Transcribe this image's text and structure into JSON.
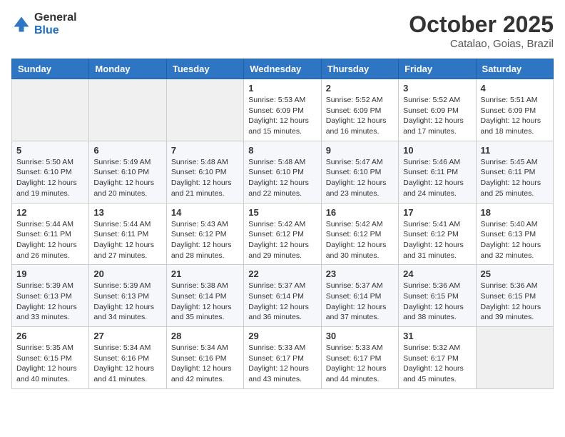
{
  "logo": {
    "general": "General",
    "blue": "Blue"
  },
  "title": "October 2025",
  "location": "Catalao, Goias, Brazil",
  "days_of_week": [
    "Sunday",
    "Monday",
    "Tuesday",
    "Wednesday",
    "Thursday",
    "Friday",
    "Saturday"
  ],
  "weeks": [
    [
      {
        "day": "",
        "sunrise": "",
        "sunset": "",
        "daylight": ""
      },
      {
        "day": "",
        "sunrise": "",
        "sunset": "",
        "daylight": ""
      },
      {
        "day": "",
        "sunrise": "",
        "sunset": "",
        "daylight": ""
      },
      {
        "day": "1",
        "sunrise": "Sunrise: 5:53 AM",
        "sunset": "Sunset: 6:09 PM",
        "daylight": "Daylight: 12 hours and 15 minutes."
      },
      {
        "day": "2",
        "sunrise": "Sunrise: 5:52 AM",
        "sunset": "Sunset: 6:09 PM",
        "daylight": "Daylight: 12 hours and 16 minutes."
      },
      {
        "day": "3",
        "sunrise": "Sunrise: 5:52 AM",
        "sunset": "Sunset: 6:09 PM",
        "daylight": "Daylight: 12 hours and 17 minutes."
      },
      {
        "day": "4",
        "sunrise": "Sunrise: 5:51 AM",
        "sunset": "Sunset: 6:09 PM",
        "daylight": "Daylight: 12 hours and 18 minutes."
      }
    ],
    [
      {
        "day": "5",
        "sunrise": "Sunrise: 5:50 AM",
        "sunset": "Sunset: 6:10 PM",
        "daylight": "Daylight: 12 hours and 19 minutes."
      },
      {
        "day": "6",
        "sunrise": "Sunrise: 5:49 AM",
        "sunset": "Sunset: 6:10 PM",
        "daylight": "Daylight: 12 hours and 20 minutes."
      },
      {
        "day": "7",
        "sunrise": "Sunrise: 5:48 AM",
        "sunset": "Sunset: 6:10 PM",
        "daylight": "Daylight: 12 hours and 21 minutes."
      },
      {
        "day": "8",
        "sunrise": "Sunrise: 5:48 AM",
        "sunset": "Sunset: 6:10 PM",
        "daylight": "Daylight: 12 hours and 22 minutes."
      },
      {
        "day": "9",
        "sunrise": "Sunrise: 5:47 AM",
        "sunset": "Sunset: 6:10 PM",
        "daylight": "Daylight: 12 hours and 23 minutes."
      },
      {
        "day": "10",
        "sunrise": "Sunrise: 5:46 AM",
        "sunset": "Sunset: 6:11 PM",
        "daylight": "Daylight: 12 hours and 24 minutes."
      },
      {
        "day": "11",
        "sunrise": "Sunrise: 5:45 AM",
        "sunset": "Sunset: 6:11 PM",
        "daylight": "Daylight: 12 hours and 25 minutes."
      }
    ],
    [
      {
        "day": "12",
        "sunrise": "Sunrise: 5:44 AM",
        "sunset": "Sunset: 6:11 PM",
        "daylight": "Daylight: 12 hours and 26 minutes."
      },
      {
        "day": "13",
        "sunrise": "Sunrise: 5:44 AM",
        "sunset": "Sunset: 6:11 PM",
        "daylight": "Daylight: 12 hours and 27 minutes."
      },
      {
        "day": "14",
        "sunrise": "Sunrise: 5:43 AM",
        "sunset": "Sunset: 6:12 PM",
        "daylight": "Daylight: 12 hours and 28 minutes."
      },
      {
        "day": "15",
        "sunrise": "Sunrise: 5:42 AM",
        "sunset": "Sunset: 6:12 PM",
        "daylight": "Daylight: 12 hours and 29 minutes."
      },
      {
        "day": "16",
        "sunrise": "Sunrise: 5:42 AM",
        "sunset": "Sunset: 6:12 PM",
        "daylight": "Daylight: 12 hours and 30 minutes."
      },
      {
        "day": "17",
        "sunrise": "Sunrise: 5:41 AM",
        "sunset": "Sunset: 6:12 PM",
        "daylight": "Daylight: 12 hours and 31 minutes."
      },
      {
        "day": "18",
        "sunrise": "Sunrise: 5:40 AM",
        "sunset": "Sunset: 6:13 PM",
        "daylight": "Daylight: 12 hours and 32 minutes."
      }
    ],
    [
      {
        "day": "19",
        "sunrise": "Sunrise: 5:39 AM",
        "sunset": "Sunset: 6:13 PM",
        "daylight": "Daylight: 12 hours and 33 minutes."
      },
      {
        "day": "20",
        "sunrise": "Sunrise: 5:39 AM",
        "sunset": "Sunset: 6:13 PM",
        "daylight": "Daylight: 12 hours and 34 minutes."
      },
      {
        "day": "21",
        "sunrise": "Sunrise: 5:38 AM",
        "sunset": "Sunset: 6:14 PM",
        "daylight": "Daylight: 12 hours and 35 minutes."
      },
      {
        "day": "22",
        "sunrise": "Sunrise: 5:37 AM",
        "sunset": "Sunset: 6:14 PM",
        "daylight": "Daylight: 12 hours and 36 minutes."
      },
      {
        "day": "23",
        "sunrise": "Sunrise: 5:37 AM",
        "sunset": "Sunset: 6:14 PM",
        "daylight": "Daylight: 12 hours and 37 minutes."
      },
      {
        "day": "24",
        "sunrise": "Sunrise: 5:36 AM",
        "sunset": "Sunset: 6:15 PM",
        "daylight": "Daylight: 12 hours and 38 minutes."
      },
      {
        "day": "25",
        "sunrise": "Sunrise: 5:36 AM",
        "sunset": "Sunset: 6:15 PM",
        "daylight": "Daylight: 12 hours and 39 minutes."
      }
    ],
    [
      {
        "day": "26",
        "sunrise": "Sunrise: 5:35 AM",
        "sunset": "Sunset: 6:15 PM",
        "daylight": "Daylight: 12 hours and 40 minutes."
      },
      {
        "day": "27",
        "sunrise": "Sunrise: 5:34 AM",
        "sunset": "Sunset: 6:16 PM",
        "daylight": "Daylight: 12 hours and 41 minutes."
      },
      {
        "day": "28",
        "sunrise": "Sunrise: 5:34 AM",
        "sunset": "Sunset: 6:16 PM",
        "daylight": "Daylight: 12 hours and 42 minutes."
      },
      {
        "day": "29",
        "sunrise": "Sunrise: 5:33 AM",
        "sunset": "Sunset: 6:17 PM",
        "daylight": "Daylight: 12 hours and 43 minutes."
      },
      {
        "day": "30",
        "sunrise": "Sunrise: 5:33 AM",
        "sunset": "Sunset: 6:17 PM",
        "daylight": "Daylight: 12 hours and 44 minutes."
      },
      {
        "day": "31",
        "sunrise": "Sunrise: 5:32 AM",
        "sunset": "Sunset: 6:17 PM",
        "daylight": "Daylight: 12 hours and 45 minutes."
      },
      {
        "day": "",
        "sunrise": "",
        "sunset": "",
        "daylight": ""
      }
    ]
  ]
}
